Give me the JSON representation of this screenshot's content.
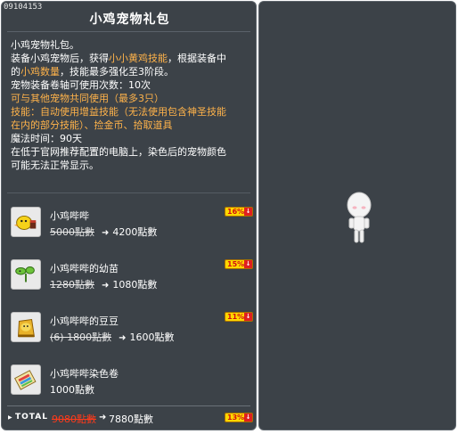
{
  "item": {
    "id": "09104153",
    "title": "小鸡宠物礼包"
  },
  "description": {
    "l1": "小鸡宠物礼包。",
    "l2a": "装备小鸡宠物后，获得",
    "l2b": "小小黄鸡技能",
    "l2c": "，根据装备中",
    "l3a": "的",
    "l3b": "小鸡数量",
    "l3c": "，技能最多强化至3阶段。",
    "l4": "宠物装备卷轴可使用次数：10次",
    "l5": "可与其他宠物共同使用（最多3只）",
    "l6": "技能：自动使用增益技能（无法使用包含神圣技能",
    "l7": "在内的部分技能）、捡金币、拾取道具",
    "l8": "魔法时间：90天",
    "l9": "在低于官网推荐配置的电脑上，染色后的宠物颜色",
    "l10": "可能无法正常显示。"
  },
  "items": [
    {
      "name": "小鸡哔哔",
      "old_price": "5000點數",
      "new_price": "4200點數",
      "discount": "16%",
      "icon": "chick-pet-icon"
    },
    {
      "name": "小鸡哔哔的幼苗",
      "old_price": "1280點數",
      "new_price": "1080點數",
      "discount": "15%",
      "icon": "sprout-icon"
    },
    {
      "name": "小鸡哔哔的豆豆",
      "old_price": "(6) 1800點數",
      "new_price": "1600點數",
      "discount": "11%",
      "icon": "bean-sack-icon"
    },
    {
      "name": "小鸡哔哔染色卷",
      "old_price": "",
      "new_price": "1000點數",
      "discount": "",
      "icon": "dye-scroll-icon"
    }
  ],
  "total": {
    "label": "TOTAL",
    "old_price": "9080點數",
    "new_price": "7880點數",
    "discount": "13%"
  },
  "colors": {
    "panel_bg": "#3c4248",
    "highlight": "#ffb34a",
    "total_old_price": "#ff3a1a",
    "badge_bg": "#ffd800",
    "badge_text": "#d01010"
  }
}
